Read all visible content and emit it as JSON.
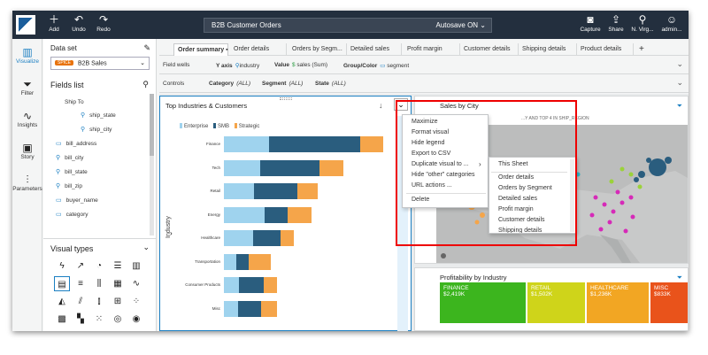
{
  "topbar": {
    "buttons": [
      {
        "label": "Add",
        "icon": "plus-icon"
      },
      {
        "label": "Undo",
        "icon": "undo-icon"
      },
      {
        "label": "Redo",
        "icon": "redo-icon"
      }
    ],
    "title": "B2B Customer Orders",
    "autosave": "Autosave ON",
    "right_buttons": [
      {
        "label": "Capture",
        "icon": "camera-icon"
      },
      {
        "label": "Share",
        "icon": "share-icon"
      },
      {
        "label": "N. Virg...",
        "icon": "location-icon"
      },
      {
        "label": "admin...",
        "icon": "user-icon"
      }
    ]
  },
  "rail": [
    {
      "label": "Visualize",
      "icon": "visualize-icon",
      "active": true
    },
    {
      "label": "Filter",
      "icon": "filter-icon"
    },
    {
      "label": "Insights",
      "icon": "insights-icon"
    },
    {
      "label": "Story",
      "icon": "story-icon"
    },
    {
      "label": "Parameters",
      "icon": "parameters-icon"
    }
  ],
  "fields_panel": {
    "dataset_label": "Data set",
    "dataset_badge": "SPICE",
    "dataset_value": "B2B Sales",
    "fields_list_label": "Fields list",
    "group_label": "Ship To",
    "fields": [
      "ship_state",
      "ship_city",
      "bill_address",
      "bill_city",
      "bill_state",
      "bill_zip",
      "buyer_name",
      "category"
    ],
    "visual_types_label": "Visual types"
  },
  "tabs": [
    "Order summary",
    "Order details",
    "Orders by Segm...",
    "Detailed sales",
    "Profit margin",
    "Customer details",
    "Shipping details",
    "Product details"
  ],
  "field_wells": {
    "label": "Field wells",
    "y_axis_label": "Y axis",
    "y_axis_value": "industry",
    "value_label": "Value",
    "value_value": "sales (Sum)",
    "color_label": "Group/Color",
    "color_value": "segment"
  },
  "controls": {
    "label": "Controls",
    "items": [
      {
        "name": "Category",
        "value": "(ALL)"
      },
      {
        "name": "Segment",
        "value": "(ALL)"
      },
      {
        "name": "State",
        "value": "(ALL)"
      }
    ]
  },
  "chart_data": {
    "type": "bar",
    "orientation": "horizontal",
    "stacked": true,
    "title": "Top Industries & Customers",
    "ylabel": "Industry",
    "categories": [
      "Finance",
      "Tech",
      "Retail",
      "Energy",
      "Healthcare",
      "Transportation",
      "Consumer Products",
      "Misc"
    ],
    "series": [
      {
        "name": "Enterprise",
        "color": "#9fd3ee",
        "values": [
          50,
          40,
          33,
          45,
          32,
          14,
          17,
          16
        ]
      },
      {
        "name": "SMB",
        "color": "#2a5d7e",
        "values": [
          100,
          65,
          48,
          25,
          30,
          13,
          27,
          25
        ]
      },
      {
        "name": "Strategic",
        "color": "#f5a54a",
        "values": [
          25,
          26,
          22,
          26,
          15,
          25,
          14,
          17
        ]
      }
    ]
  },
  "visual_menu": {
    "items": [
      "Maximize",
      "Format visual",
      "Hide legend",
      "Export to CSV",
      "Duplicate visual to ...",
      "Hide \"other\" categories",
      "URL actions ...",
      "Delete"
    ],
    "submenu": [
      "This Sheet",
      "Order details",
      "Orders by Segment",
      "Detailed sales",
      "Profit margin",
      "Customer details",
      "Shipping details"
    ]
  },
  "map_visual": {
    "title": "Sales by City",
    "subtitle": "...Y AND TOP 4 IN SHIP_REGION"
  },
  "profitability": {
    "title": "Profitability by Industry",
    "cells": [
      {
        "label": "FINANCE",
        "value": "$2,419K",
        "color": "#3cb51e"
      },
      {
        "label": "RETAIL",
        "value": "$1,502K",
        "color": "#cfd41a"
      },
      {
        "label": "HEALTHCARE",
        "value": "$1,236K",
        "color": "#f2a623"
      },
      {
        "label": "MISC",
        "value": "$833K",
        "color": "#e9531b"
      }
    ]
  }
}
